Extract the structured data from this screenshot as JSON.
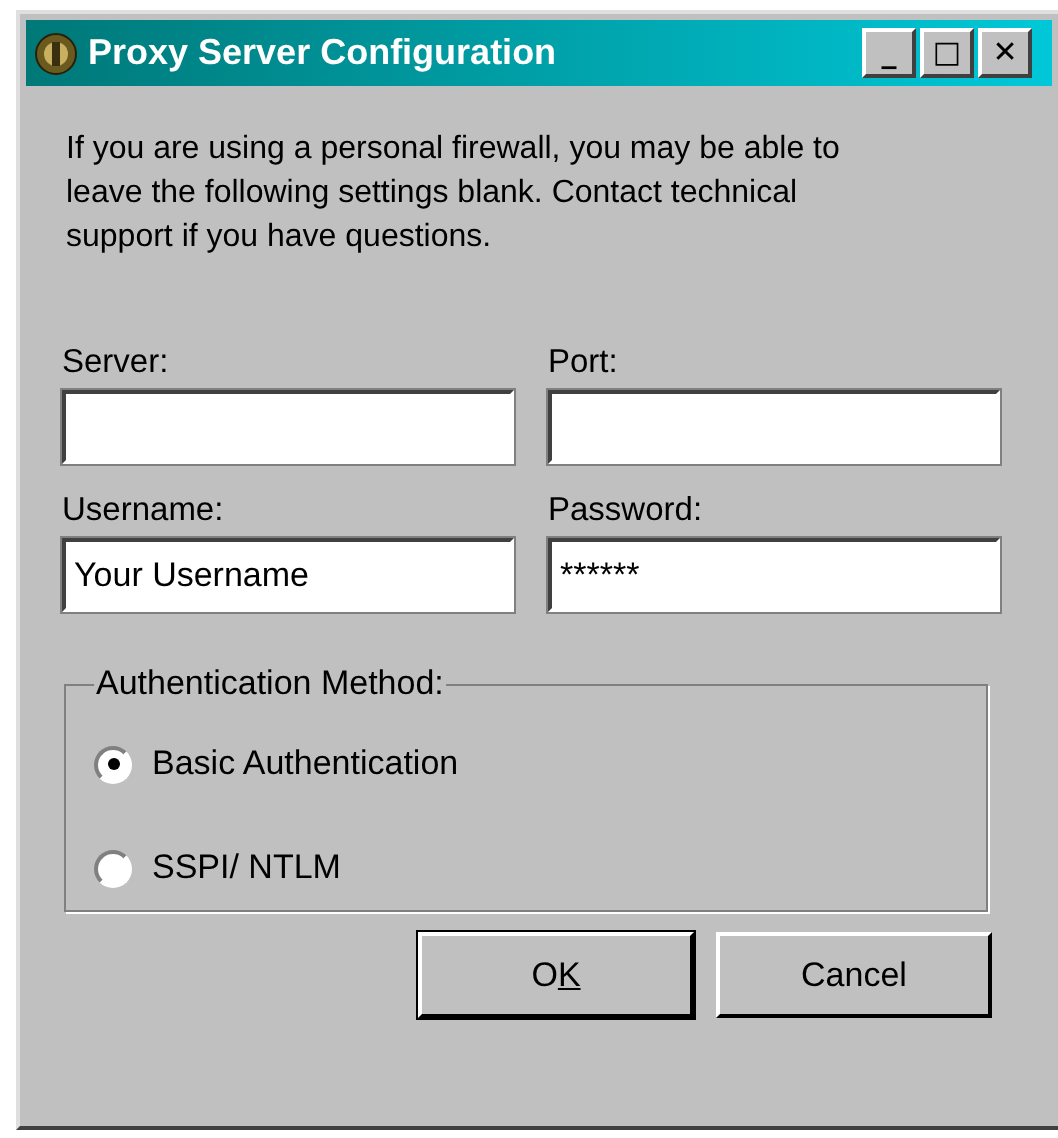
{
  "window": {
    "title": "Proxy Server Configuration",
    "controls": [
      "_",
      "□",
      "✕"
    ]
  },
  "intro": "If you are using a personal firewall, you may be able to leave the following settings blank. Contact technical support if you have questions.",
  "fields": [
    {
      "label": "Server:"
    },
    {
      "label": "Port:"
    },
    {
      "label": "Username:",
      "value": "Your Username"
    },
    {
      "label": "Password:",
      "value": "******"
    }
  ],
  "auth": {
    "legend": "Authentication Method:",
    "options": [
      {
        "label": "Basic Authentication",
        "selected": true
      },
      {
        "label": "SSPI/ NTLM",
        "selected": false
      }
    ]
  },
  "buttons": [
    {
      "label": "O",
      "accelerator": "K"
    },
    {
      "label": "Cancel"
    }
  ]
}
